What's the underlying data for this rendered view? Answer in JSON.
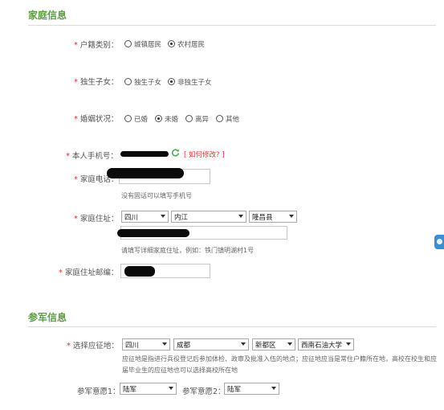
{
  "family": {
    "title": "家庭信息",
    "hukou": {
      "label": "户籍类别：",
      "options": [
        "城镇居民",
        "农村居民"
      ]
    },
    "only_child": {
      "label": "独生子女：",
      "options": [
        "独生子女",
        "非独生子女"
      ]
    },
    "marital": {
      "label": "婚姻状况：",
      "options": [
        "已婚",
        "未婚",
        "离异",
        "其他"
      ]
    },
    "phone": {
      "label": "本人手机号：",
      "link": "[ 如何修改? ]"
    },
    "home_phone": {
      "label": "家庭电话：",
      "hint": "没有固话可以填写手机号"
    },
    "address": {
      "label": "家庭住址：",
      "province": "四川",
      "city": "内江",
      "county": "隆昌县",
      "hint": "请填写详细家庭住址，例如：铁门镇明湖村1号"
    },
    "postcode": {
      "label": "家庭住址邮编："
    }
  },
  "military": {
    "title": "参军信息",
    "place": {
      "label": "选择应征地：",
      "province": "四川",
      "city": "成都",
      "district": "新都区",
      "school": "西南石油大学",
      "hint": "应征地是指进行兵役登记后参加体检、政审及批准入伍的地点；应征地应当是常住户籍所在地，高校在校生和应届毕业生的应征地也可以选择高校所在地"
    },
    "wish1": {
      "label": "参军意愿1：",
      "value": "陆军"
    },
    "wish2": {
      "label": "参军意愿2：",
      "value": "陆军"
    }
  }
}
